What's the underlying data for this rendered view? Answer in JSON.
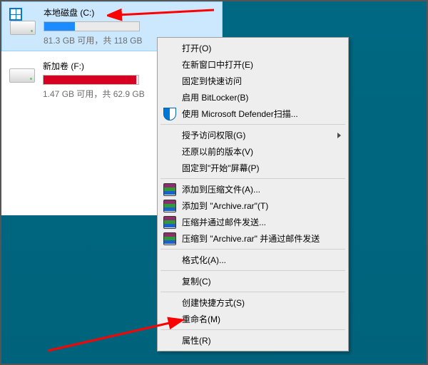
{
  "drives": [
    {
      "name": "本地磁盘 (C:)",
      "stats": "81.3 GB 可用，共 118 GB"
    },
    {
      "name": "新加卷 (F:)",
      "stats": "1.47 GB 可用，共 62.9 GB"
    }
  ],
  "menu": {
    "open": "打开(O)",
    "open_new_window": "在新窗口中打开(E)",
    "pin_quick": "固定到快速访问",
    "bitlocker": "启用 BitLocker(B)",
    "defender": "使用 Microsoft Defender扫描...",
    "grant_access": "授予访问权限(G)",
    "prev_versions": "还原以前的版本(V)",
    "pin_start": "固定到\"开始\"屏幕(P)",
    "rar_add": "添加到压缩文件(A)...",
    "rar_add_archive": "添加到 \"Archive.rar\"(T)",
    "rar_email": "压缩并通过邮件发送...",
    "rar_email_arc": "压缩到 \"Archive.rar\" 并通过邮件发送",
    "format": "格式化(A)...",
    "copy": "复制(C)",
    "shortcut": "创建快捷方式(S)",
    "rename": "重命名(M)",
    "properties": "属性(R)"
  }
}
